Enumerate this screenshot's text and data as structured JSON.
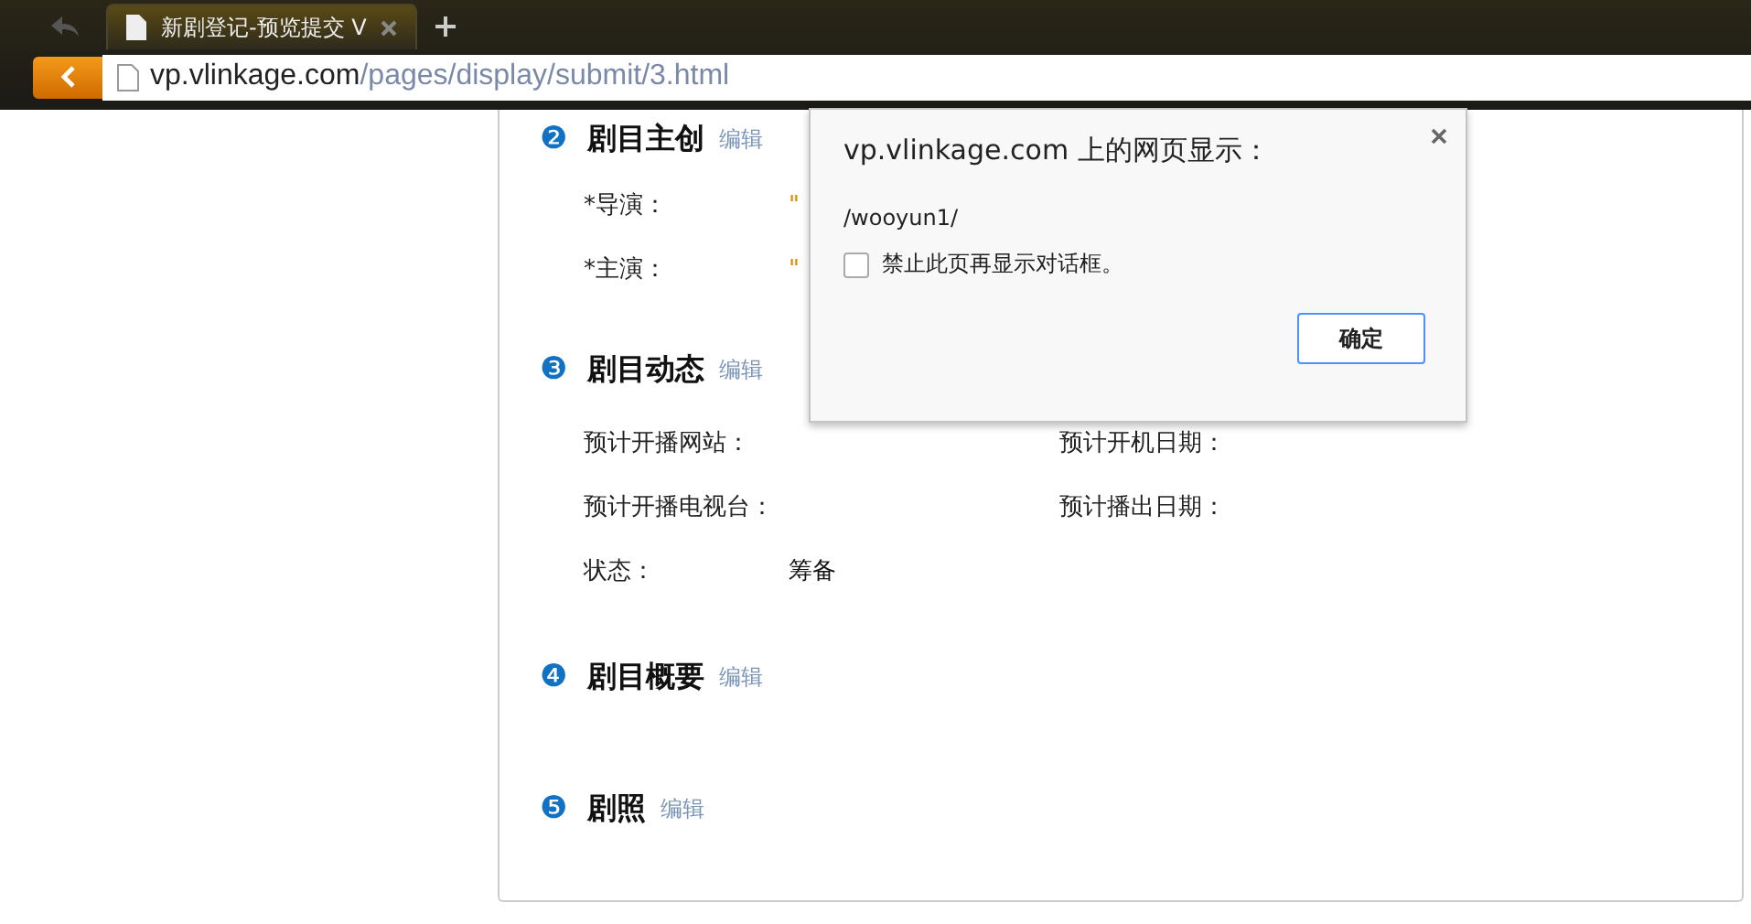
{
  "browser": {
    "tab": {
      "title": "新剧登记-预览提交 V",
      "selected": true
    },
    "address": {
      "host": "vp.vlinkage.com",
      "path": "/pages/display/submit/3.html"
    }
  },
  "sections": [
    {
      "number": "❷",
      "title": "剧目主创",
      "edit": "编辑",
      "fields": [
        {
          "label": "*导演：",
          "value": "\""
        },
        {
          "label": "*主演：",
          "value": "\""
        }
      ]
    },
    {
      "number": "❸",
      "title": "剧目动态",
      "edit": "编辑",
      "fields": [
        {
          "label": "预计开播网站："
        },
        {
          "label": "预计开机日期："
        },
        {
          "label": "预计开播电视台："
        },
        {
          "label": "预计播出日期："
        },
        {
          "label": "状态：",
          "value": "筹备"
        }
      ]
    },
    {
      "number": "❹",
      "title": "剧目概要",
      "edit": "编辑"
    },
    {
      "number": "❺",
      "title": "剧照",
      "edit": "编辑"
    }
  ],
  "dialog": {
    "title": "vp.vlinkage.com 上的网页显示：",
    "message": "/wooyun1/",
    "checkbox": {
      "label": "禁止此页再显示对话框。",
      "checked": false
    },
    "button": "确定"
  }
}
